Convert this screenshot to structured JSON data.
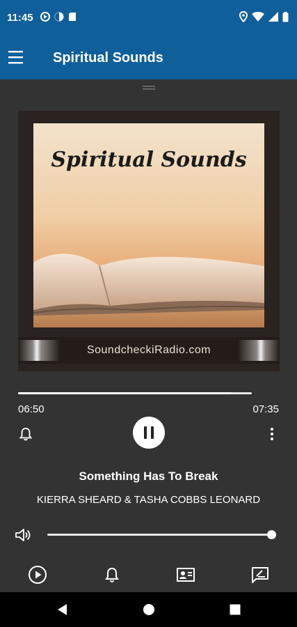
{
  "status_bar": {
    "time": "11:45",
    "left_icons": [
      "media-play-icon",
      "data-saver-icon",
      "sd-card-icon"
    ],
    "right_icons": [
      "location-icon",
      "wifi-icon",
      "signal-icon",
      "battery-icon"
    ]
  },
  "app_bar": {
    "title": "Spiritual Sounds",
    "menu_icon": "hamburger-menu-icon"
  },
  "album_art": {
    "title": "Spiritual Sounds",
    "banner_text": "SoundcheckiRadio.com"
  },
  "player": {
    "progress": 0.915,
    "current_time": "06:50",
    "total_time": "07:35",
    "state": "playing",
    "song_title": "Something Has To Break",
    "artist": "KIERRA SHEARD & TASHA COBBS LEONARD",
    "volume": 1.0
  },
  "bottom_nav": [
    "play-circle-icon",
    "bell-icon",
    "contact-card-icon",
    "feedback-icon"
  ],
  "colors": {
    "app_bar": "#0f5f9a",
    "background": "#333333",
    "text": "#ffffff"
  }
}
